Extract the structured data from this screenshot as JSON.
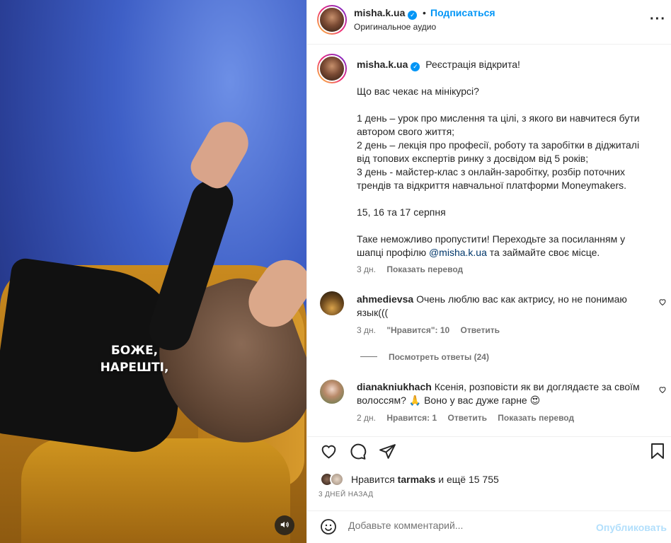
{
  "media": {
    "caption_line1": "БОЖЕ,",
    "caption_line2": "НАРЕШТІ,",
    "audio_icon": "speaker-icon"
  },
  "header": {
    "username": "misha.k.ua",
    "separator": "•",
    "follow_label": "Подписаться",
    "audio_label": "Оригинальное аудио",
    "more_icon": "more-horizontal-icon"
  },
  "caption": {
    "username": "misha.k.ua",
    "lines": [
      "Реєстрація відкрита!",
      "",
      "Що вас чекає на мінікурсі?",
      "",
      "1 день – урок про мислення та цілі, з якого ви навчитеся бути автором свого життя;",
      "2 день – лекція про професії, роботу та заробітки в діджиталі від топових експертів ринку з досвідом від 5 років;",
      "3 день - майстер-клас з онлайн-заробітку, розбір поточних трендів та відкриття навчальної платформи Moneymakers.",
      "",
      "15, 16 та 17 серпня",
      "",
      "Таке неможливо пропустити! Переходьте за посиланням у шапці профілю"
    ],
    "mention": "@misha.k.ua",
    "tail": "та займайте своє місце.",
    "age": "3 дн.",
    "translate": "Показать перевод"
  },
  "comments": [
    {
      "username": "ahmedievsa",
      "text": "Очень люблю вас как актрису, но не понимаю язык(((",
      "age": "3 дн.",
      "likes": "\"Нравится\": 10",
      "reply": "Ответить",
      "view_replies": "Посмотреть ответы (24)"
    },
    {
      "username": "dianakniukhach",
      "text": "Ксенія, розповісти як ви доглядаєте за своїм волоссям? 🙏 Воно у вас дуже гарне 😍",
      "age": "2 дн.",
      "likes": "Нравится: 1",
      "reply": "Ответить",
      "translate": "Показать перевод"
    }
  ],
  "actions": {
    "likes_prefix": "Нравится",
    "likes_user": "tarmaks",
    "likes_suffix": "и ещё 15 755",
    "date": "3 ДНЕЙ НАЗАД"
  },
  "composer": {
    "placeholder": "Добавьте комментарий...",
    "publish_label": "Опубликовать"
  }
}
